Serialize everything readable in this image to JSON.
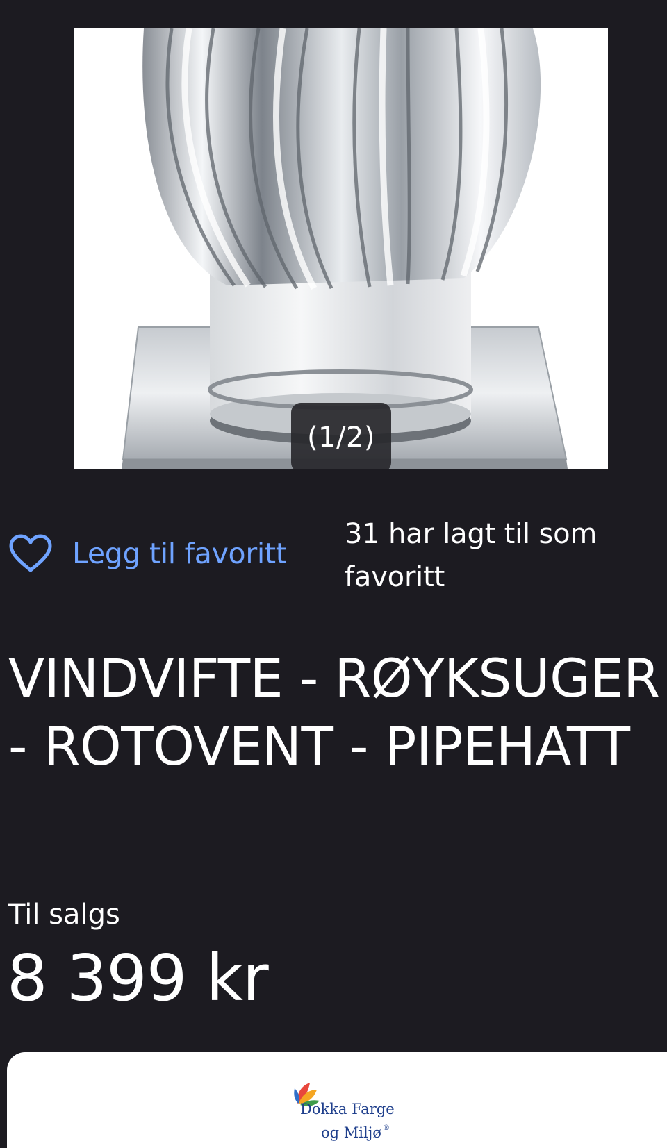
{
  "gallery": {
    "counter": "(1/2)",
    "image_subject": "chimney turbine ventilator"
  },
  "favorite": {
    "button_label": "Legg til favoritt",
    "count_text": "31 har lagt til som favoritt",
    "icon": "heart-outline-icon",
    "accent_color": "#6fa3ff"
  },
  "listing": {
    "title": "VINDVIFTE - RØYKSUGER - ROTOVENT - PIPEHATT",
    "status": "Til salgs",
    "price": "8 399 kr"
  },
  "seller": {
    "logo_name": "Dokka Farge",
    "logo_sub": "og Miljø",
    "logo_mark": "®"
  },
  "colors": {
    "background": "#1c1b21",
    "text": "#ffffff",
    "link": "#6fa3ff"
  }
}
